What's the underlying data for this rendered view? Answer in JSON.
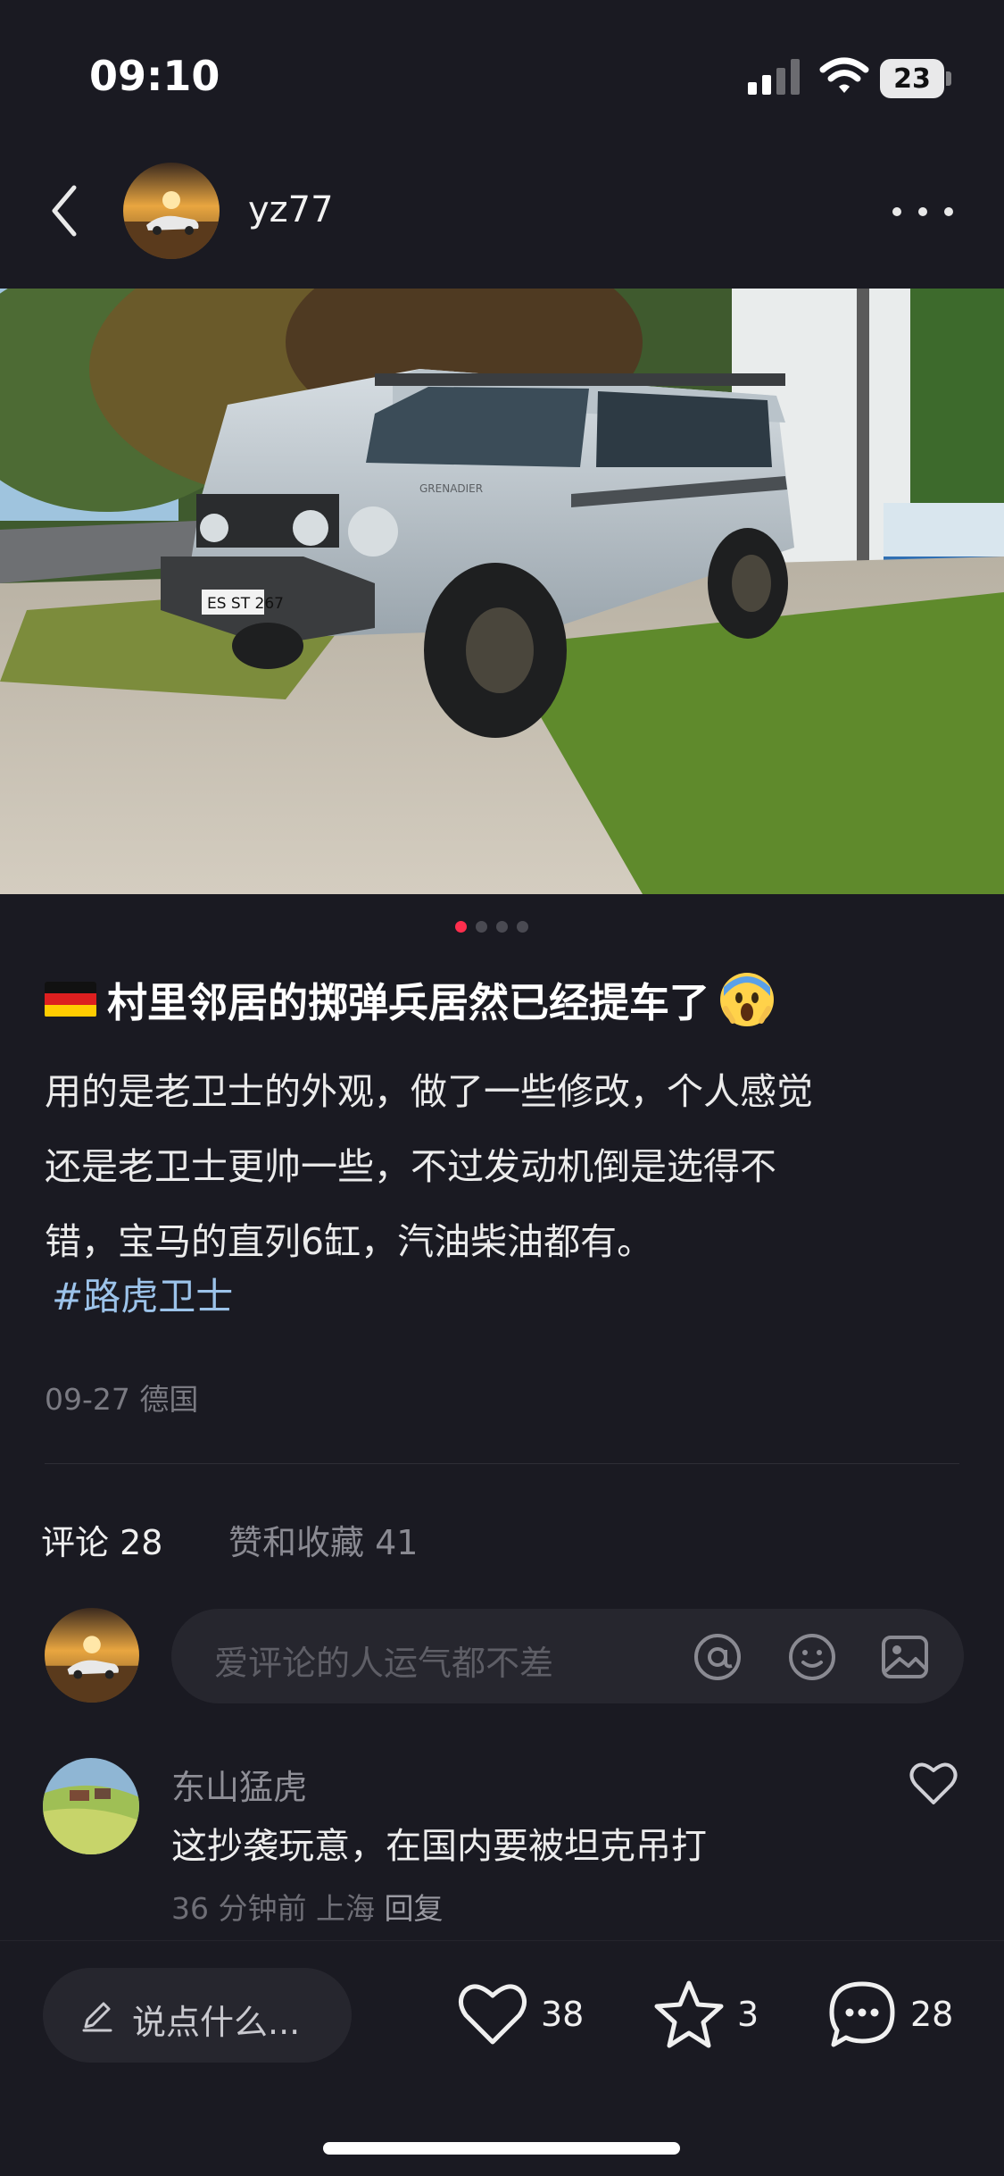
{
  "status_bar": {
    "time": "09:10",
    "battery": "23"
  },
  "header": {
    "author": "yz77"
  },
  "post": {
    "title": "村里邻居的掷弹兵居然已经提车了",
    "body_lines": [
      "用的是老卫士的外观，做了一些修改，个人感觉",
      "还是老卫士更帅一些，不过发动机倒是选得不",
      "错，宝马的直列6缸，汽油柴油都有。"
    ],
    "hashtag": "#路虎卫士",
    "date": "09-27",
    "location": "德国",
    "image": {
      "plate": "ES ST 267",
      "badge": "GRENADIER"
    },
    "carousel": {
      "total": 4,
      "active": 1
    }
  },
  "tabs": {
    "comments": "评论 28",
    "likes": "赞和收藏 41"
  },
  "comment_input": {
    "placeholder": "爱评论的人运气都不差"
  },
  "comments": [
    {
      "user": "东山猛虎",
      "text": "这抄袭玩意，在国内要被坦克吊打",
      "time": "36 分钟前",
      "location": "上海",
      "reply": "回复"
    }
  ],
  "bottom_bar": {
    "say": "说点什么...",
    "likes": "38",
    "stars": "3",
    "comments": "28"
  },
  "colors": {
    "background": "#1a1a22",
    "accent": "#ff2e4d",
    "hashtag": "#9cc3ea"
  }
}
